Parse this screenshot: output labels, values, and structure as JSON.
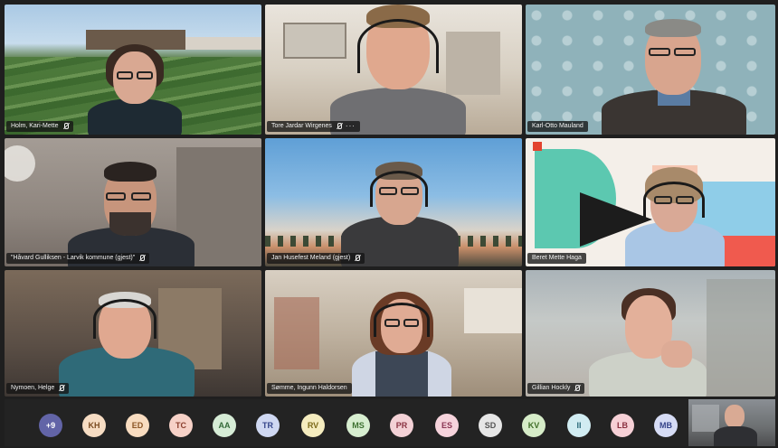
{
  "participants": [
    {
      "name": "Holm, Kari-Mette",
      "more": ""
    },
    {
      "name": "Tore Jardar Wirgenes",
      "more": "···"
    },
    {
      "name": "Karl-Otto Mauland",
      "more": ""
    },
    {
      "name": "\"Håvard Gulliksen - Larvik kommune (gjest)\"",
      "more": ""
    },
    {
      "name": "Jan Husefest Meland (gjest)",
      "more": ""
    },
    {
      "name": "Beret Mette Haga",
      "more": ""
    },
    {
      "name": "Nymoen, Helge",
      "more": ""
    },
    {
      "name": "Sømme, Ingunn Haldorsen",
      "more": ""
    },
    {
      "name": "Gillian Hockly",
      "more": ""
    }
  ],
  "tray": {
    "overflow": "+9",
    "avatars": [
      {
        "initials": "KH",
        "bg": "#f6dcc3",
        "fg": "#7a4b20"
      },
      {
        "initials": "ED",
        "bg": "#f8dcc0",
        "fg": "#8a5424"
      },
      {
        "initials": "TC",
        "bg": "#f6d1c7",
        "fg": "#8a3e2d"
      },
      {
        "initials": "AA",
        "bg": "#d6ecd6",
        "fg": "#356b3a"
      },
      {
        "initials": "TR",
        "bg": "#cfd8f2",
        "fg": "#34458a"
      },
      {
        "initials": "RV",
        "bg": "#f5ecbf",
        "fg": "#7c6a1a"
      },
      {
        "initials": "MS",
        "bg": "#d7eed0",
        "fg": "#3d7131"
      },
      {
        "initials": "PR",
        "bg": "#f3d1d6",
        "fg": "#8a3343"
      },
      {
        "initials": "ES",
        "bg": "#f6d3dc",
        "fg": "#8a3553"
      },
      {
        "initials": "SD",
        "bg": "#e6e6e6",
        "fg": "#555555"
      },
      {
        "initials": "KV",
        "bg": "#d6ecc8",
        "fg": "#3f6e27"
      },
      {
        "initials": "II",
        "bg": "#d1ecf2",
        "fg": "#2c6a7a"
      },
      {
        "initials": "LB",
        "bg": "#f6d0d6",
        "fg": "#8a3040"
      },
      {
        "initials": "MB",
        "bg": "#d6dcf5",
        "fg": "#36448a"
      }
    ]
  },
  "colors": {
    "overflow_bg": "#6264a7",
    "tray_bg": "#232323"
  }
}
